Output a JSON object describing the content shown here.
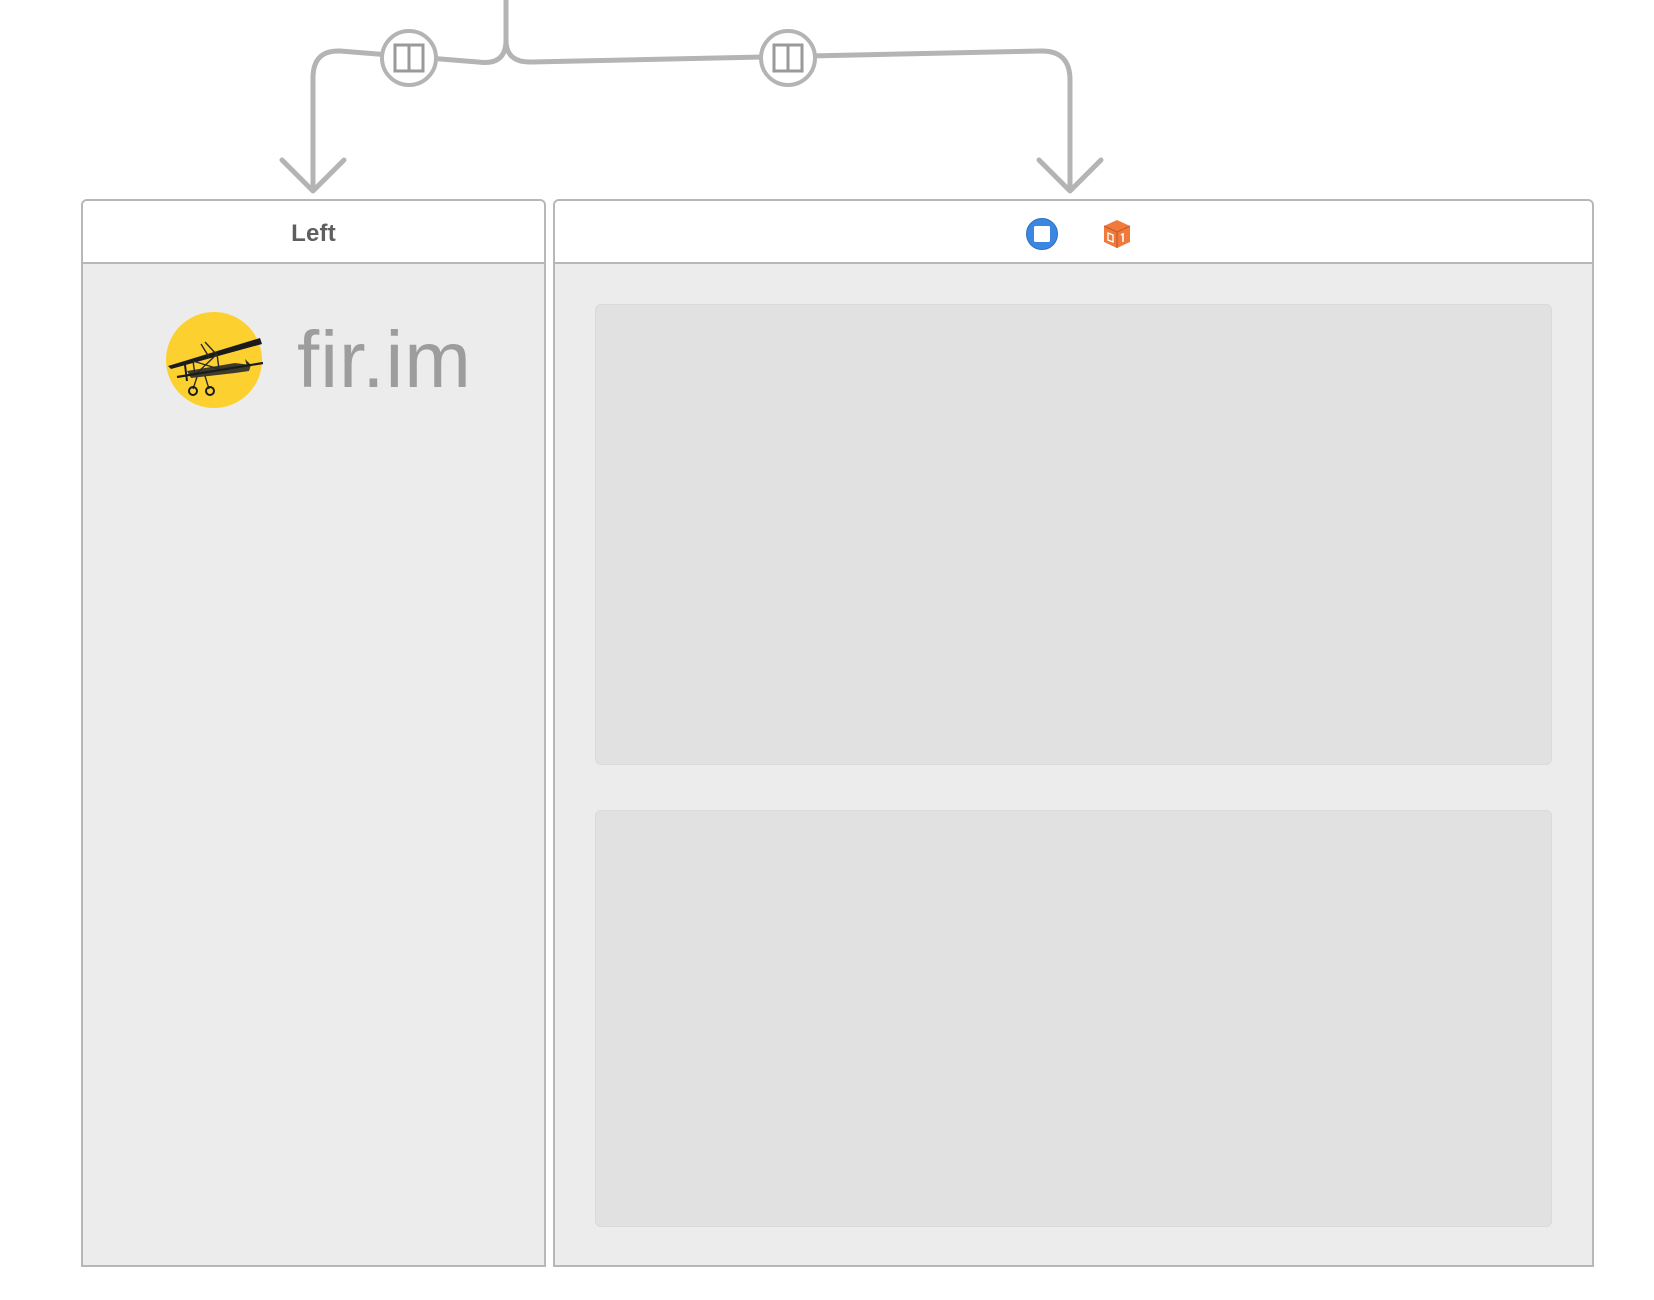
{
  "canvas": {
    "background": "#ffffff",
    "connector_color": "#b4b4b4"
  },
  "segues": [
    {
      "icon": "split-view-relationship-icon",
      "target": "left-scene"
    },
    {
      "icon": "split-view-relationship-icon",
      "target": "right-scene"
    }
  ],
  "left_scene": {
    "title": "Left",
    "logo": {
      "icon": "biplane-logo-icon",
      "text": "fir.im",
      "circle_color": "#fcd12f"
    }
  },
  "right_scene": {
    "title": "",
    "bar_icons": [
      "view-controller-icon",
      "first-responder-cube-icon"
    ],
    "view_controller_color": "#3a86e0",
    "cube_color": "#f07a3c",
    "containers": [
      "top-container-view",
      "bottom-container-view"
    ]
  }
}
